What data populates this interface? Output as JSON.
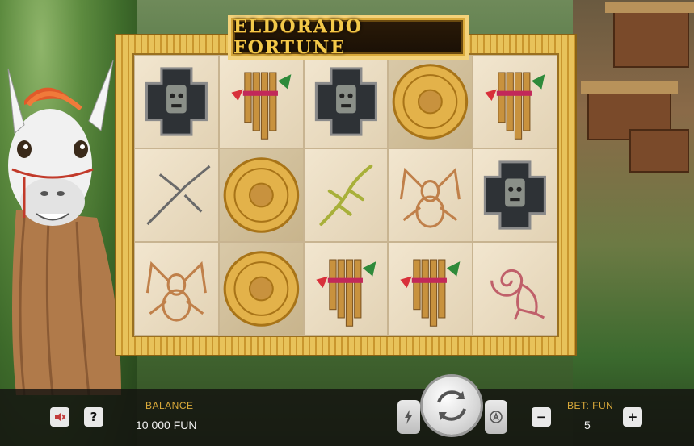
{
  "game": {
    "title": "ELDORADO FORTUNE"
  },
  "reels": [
    [
      "cross-idol",
      "pan-flute",
      "cross-idol",
      "sun-disc",
      "pan-flute"
    ],
    [
      "hummingbird",
      "sun-disc",
      "lizard",
      "spider",
      "cross-idol"
    ],
    [
      "spider",
      "sun-disc",
      "pan-flute",
      "pan-flute",
      "monkey"
    ]
  ],
  "controls": {
    "mute_icon": "speaker-muted-icon",
    "help_label": "?",
    "balance_label": "BALANCE",
    "balance_value": "10 000 FUN",
    "turbo_icon": "lightning-icon",
    "spin_icon": "refresh-arrows-icon",
    "autoplay_icon": "autoplay-a-icon",
    "bet_label": "BET: FUN",
    "bet_value": "5",
    "bet_minus": "−",
    "bet_plus": "+"
  },
  "colors": {
    "gold": "#d9a93a",
    "frame_gold": "#e0b44a",
    "bar": "#141210"
  }
}
